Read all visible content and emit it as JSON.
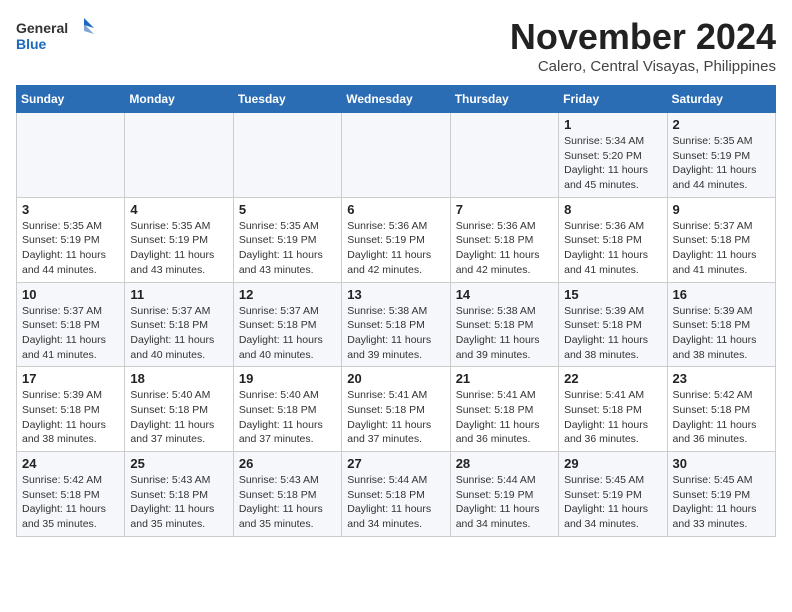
{
  "header": {
    "logo_general": "General",
    "logo_blue": "Blue",
    "month_year": "November 2024",
    "location": "Calero, Central Visayas, Philippines"
  },
  "days_of_week": [
    "Sunday",
    "Monday",
    "Tuesday",
    "Wednesday",
    "Thursday",
    "Friday",
    "Saturday"
  ],
  "weeks": [
    [
      {
        "day": "",
        "info": ""
      },
      {
        "day": "",
        "info": ""
      },
      {
        "day": "",
        "info": ""
      },
      {
        "day": "",
        "info": ""
      },
      {
        "day": "",
        "info": ""
      },
      {
        "day": "1",
        "info": "Sunrise: 5:34 AM\nSunset: 5:20 PM\nDaylight: 11 hours and 45 minutes."
      },
      {
        "day": "2",
        "info": "Sunrise: 5:35 AM\nSunset: 5:19 PM\nDaylight: 11 hours and 44 minutes."
      }
    ],
    [
      {
        "day": "3",
        "info": "Sunrise: 5:35 AM\nSunset: 5:19 PM\nDaylight: 11 hours and 44 minutes."
      },
      {
        "day": "4",
        "info": "Sunrise: 5:35 AM\nSunset: 5:19 PM\nDaylight: 11 hours and 43 minutes."
      },
      {
        "day": "5",
        "info": "Sunrise: 5:35 AM\nSunset: 5:19 PM\nDaylight: 11 hours and 43 minutes."
      },
      {
        "day": "6",
        "info": "Sunrise: 5:36 AM\nSunset: 5:19 PM\nDaylight: 11 hours and 42 minutes."
      },
      {
        "day": "7",
        "info": "Sunrise: 5:36 AM\nSunset: 5:18 PM\nDaylight: 11 hours and 42 minutes."
      },
      {
        "day": "8",
        "info": "Sunrise: 5:36 AM\nSunset: 5:18 PM\nDaylight: 11 hours and 41 minutes."
      },
      {
        "day": "9",
        "info": "Sunrise: 5:37 AM\nSunset: 5:18 PM\nDaylight: 11 hours and 41 minutes."
      }
    ],
    [
      {
        "day": "10",
        "info": "Sunrise: 5:37 AM\nSunset: 5:18 PM\nDaylight: 11 hours and 41 minutes."
      },
      {
        "day": "11",
        "info": "Sunrise: 5:37 AM\nSunset: 5:18 PM\nDaylight: 11 hours and 40 minutes."
      },
      {
        "day": "12",
        "info": "Sunrise: 5:37 AM\nSunset: 5:18 PM\nDaylight: 11 hours and 40 minutes."
      },
      {
        "day": "13",
        "info": "Sunrise: 5:38 AM\nSunset: 5:18 PM\nDaylight: 11 hours and 39 minutes."
      },
      {
        "day": "14",
        "info": "Sunrise: 5:38 AM\nSunset: 5:18 PM\nDaylight: 11 hours and 39 minutes."
      },
      {
        "day": "15",
        "info": "Sunrise: 5:39 AM\nSunset: 5:18 PM\nDaylight: 11 hours and 38 minutes."
      },
      {
        "day": "16",
        "info": "Sunrise: 5:39 AM\nSunset: 5:18 PM\nDaylight: 11 hours and 38 minutes."
      }
    ],
    [
      {
        "day": "17",
        "info": "Sunrise: 5:39 AM\nSunset: 5:18 PM\nDaylight: 11 hours and 38 minutes."
      },
      {
        "day": "18",
        "info": "Sunrise: 5:40 AM\nSunset: 5:18 PM\nDaylight: 11 hours and 37 minutes."
      },
      {
        "day": "19",
        "info": "Sunrise: 5:40 AM\nSunset: 5:18 PM\nDaylight: 11 hours and 37 minutes."
      },
      {
        "day": "20",
        "info": "Sunrise: 5:41 AM\nSunset: 5:18 PM\nDaylight: 11 hours and 37 minutes."
      },
      {
        "day": "21",
        "info": "Sunrise: 5:41 AM\nSunset: 5:18 PM\nDaylight: 11 hours and 36 minutes."
      },
      {
        "day": "22",
        "info": "Sunrise: 5:41 AM\nSunset: 5:18 PM\nDaylight: 11 hours and 36 minutes."
      },
      {
        "day": "23",
        "info": "Sunrise: 5:42 AM\nSunset: 5:18 PM\nDaylight: 11 hours and 36 minutes."
      }
    ],
    [
      {
        "day": "24",
        "info": "Sunrise: 5:42 AM\nSunset: 5:18 PM\nDaylight: 11 hours and 35 minutes."
      },
      {
        "day": "25",
        "info": "Sunrise: 5:43 AM\nSunset: 5:18 PM\nDaylight: 11 hours and 35 minutes."
      },
      {
        "day": "26",
        "info": "Sunrise: 5:43 AM\nSunset: 5:18 PM\nDaylight: 11 hours and 35 minutes."
      },
      {
        "day": "27",
        "info": "Sunrise: 5:44 AM\nSunset: 5:18 PM\nDaylight: 11 hours and 34 minutes."
      },
      {
        "day": "28",
        "info": "Sunrise: 5:44 AM\nSunset: 5:19 PM\nDaylight: 11 hours and 34 minutes."
      },
      {
        "day": "29",
        "info": "Sunrise: 5:45 AM\nSunset: 5:19 PM\nDaylight: 11 hours and 34 minutes."
      },
      {
        "day": "30",
        "info": "Sunrise: 5:45 AM\nSunset: 5:19 PM\nDaylight: 11 hours and 33 minutes."
      }
    ]
  ]
}
